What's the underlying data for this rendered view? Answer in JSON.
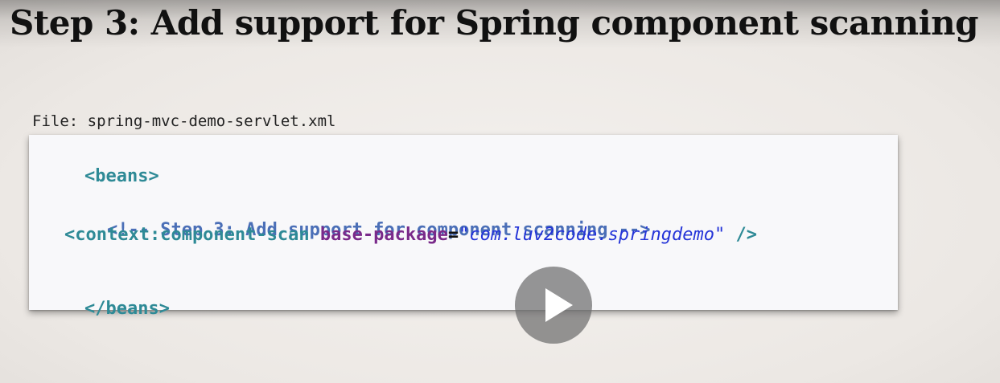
{
  "slide": {
    "title": "Step 3: Add support for Spring component scanning"
  },
  "file_label": "File: spring-mvc-demo-servlet.xml",
  "code": {
    "beans_open": "<beans>",
    "comment": "<!-- Step 3: Add support for component scanning -->",
    "scan_tag": "<context:component-scan",
    "attr_name": "base-package",
    "equals": "=",
    "attr_value": "\"com.luv2code.springdemo\"",
    "self_close": " />",
    "beans_close": "</beans>"
  },
  "video": {
    "play_icon": "play-icon"
  },
  "colors": {
    "tag": "#2e8a96",
    "comment": "#4b6fb7",
    "attribute": "#7a2a8a",
    "value": "#2434d8"
  }
}
